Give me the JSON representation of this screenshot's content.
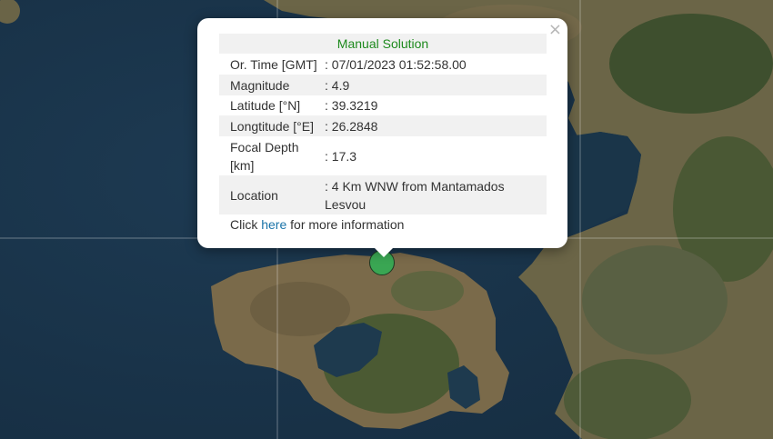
{
  "popup": {
    "title": "Manual Solution",
    "title_color": "#1e8a1e",
    "close_label": "×",
    "rows": [
      {
        "label": "Or. Time [GMT]",
        "value": ": 07/01/2023 01:52:58.00"
      },
      {
        "label": "Magnitude",
        "value": ": 4.9"
      },
      {
        "label": "Latitude [°N]",
        "value": ": 39.3219"
      },
      {
        "label": "Longtitude [°E]",
        "value": ": 26.2848"
      },
      {
        "label": "Focal Depth [km]",
        "value": ": 17.3"
      },
      {
        "label": "Location",
        "value": ": 4 Km WNW from Mantamados Lesvou"
      }
    ],
    "footer": {
      "prefix": "Click ",
      "link": "here",
      "suffix": " for more information"
    }
  },
  "marker": {
    "color": "#3aa653",
    "icon": "earthquake-epicenter-marker"
  }
}
